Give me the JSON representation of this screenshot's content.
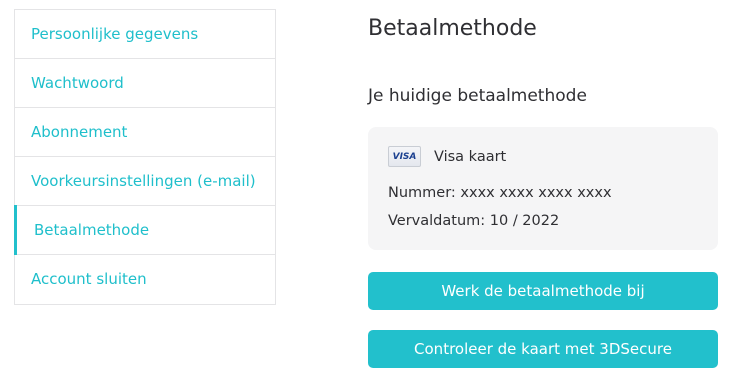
{
  "sidebar": {
    "items": [
      {
        "label": "Persoonlijke gegevens"
      },
      {
        "label": "Wachtwoord"
      },
      {
        "label": "Abonnement"
      },
      {
        "label": "Voorkeursinstellingen (e-mail)"
      },
      {
        "label": "Betaalmethode",
        "active": true
      },
      {
        "label": "Account sluiten"
      }
    ]
  },
  "main": {
    "title": "Betaalmethode",
    "subtitle": "Je huidige betaalmethode",
    "card": {
      "brand_logo": "VISA",
      "brand_name": "Visa kaart",
      "number_line": "Nummer: xxxx xxxx xxxx xxxx",
      "expiry_line": "Vervaldatum: 10 / 2022"
    },
    "buttons": {
      "update": "Werk de betaalmethode bij",
      "verify": "Controleer de kaart met 3DSecure"
    }
  },
  "colors": {
    "accent": "#22c0cc",
    "card_bg": "#f5f5f6",
    "border": "#e4e4e6"
  }
}
